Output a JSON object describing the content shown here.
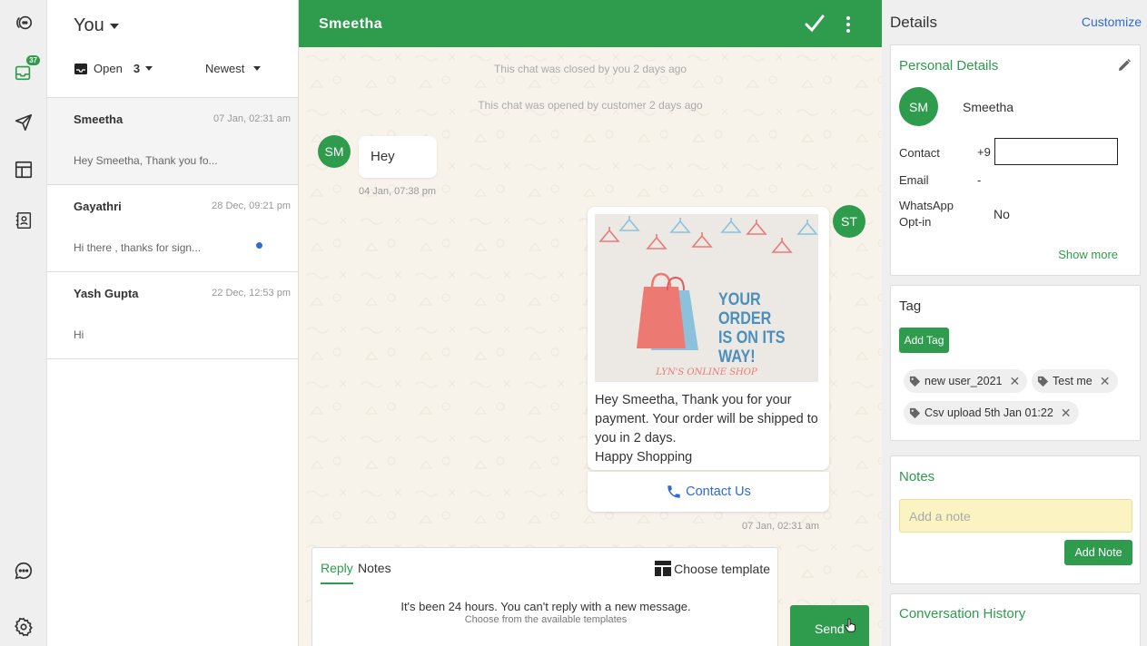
{
  "rail": {
    "inbox_badge": "37",
    "icons": [
      "logo-icon",
      "inbox-icon",
      "broadcast-send-icon",
      "templates-layout-icon",
      "contacts-icon",
      "chat-bubble-icon",
      "settings-gear-icon"
    ]
  },
  "list": {
    "owner": "You",
    "status_filter": "Open",
    "status_count": "3",
    "sort": "Newest",
    "conversations": [
      {
        "name": "Smeetha",
        "time": "07 Jan, 02:31 am",
        "snippet": "Hey Smeetha, Thank you fo...",
        "unread": false
      },
      {
        "name": "Gayathri",
        "time": "28 Dec, 09:21 pm",
        "snippet": "Hi there , thanks for sign...",
        "unread": true
      },
      {
        "name": "Yash Gupta",
        "time": "22 Dec, 12:53 pm",
        "snippet": "Hi",
        "unread": false
      }
    ]
  },
  "chat": {
    "title": "Smeetha",
    "system_closed": "This chat was closed by you 2 days ago",
    "system_opened": "This chat was opened by customer 2 days ago",
    "incoming": {
      "avatar": "SM",
      "text": "Hey",
      "time": "04 Jan, 07:38 pm"
    },
    "outgoing": {
      "avatar": "ST",
      "image_text": [
        "YOUR ORDER",
        "IS ON ITS",
        "WAY!"
      ],
      "image_caption": "LYN'S ONLINE SHOP",
      "body": "Hey Smeetha, Thank you for your payment. Your order will be shipped to you in 2 days.\nHappy Shopping",
      "button": "Contact Us",
      "time": "07 Jan, 02:31 am"
    },
    "composer": {
      "tab_reply": "Reply",
      "tab_notes": "Notes",
      "choose_template": "Choose template",
      "blocked_message": "It's been 24 hours. You can't reply with a new message.",
      "blocked_sub": "Choose from the available templates",
      "send": "Send"
    }
  },
  "details": {
    "title": "Details",
    "customize": "Customize",
    "personal": {
      "heading": "Personal Details",
      "avatar": "SM",
      "name": "Smeetha",
      "contact_label": "Contact",
      "contact_value": "+9",
      "email_label": "Email",
      "email_value": "-",
      "optin_label_1": "WhatsApp",
      "optin_label_2": "Opt-in",
      "optin_value": "No",
      "show_more": "Show more"
    },
    "tag": {
      "heading": "Tag",
      "add_button": "Add Tag",
      "tags": [
        "new user_2021",
        "Test me",
        "Csv upload 5th Jan 01:22"
      ]
    },
    "notes": {
      "heading": "Notes",
      "placeholder": "Add a note",
      "add_button": "Add Note"
    },
    "history": {
      "heading": "Conversation History"
    }
  },
  "colors": {
    "brand_green": "#2e9b4d",
    "link_blue": "#2f6bd0",
    "chat_bg": "#f7f3ea"
  }
}
